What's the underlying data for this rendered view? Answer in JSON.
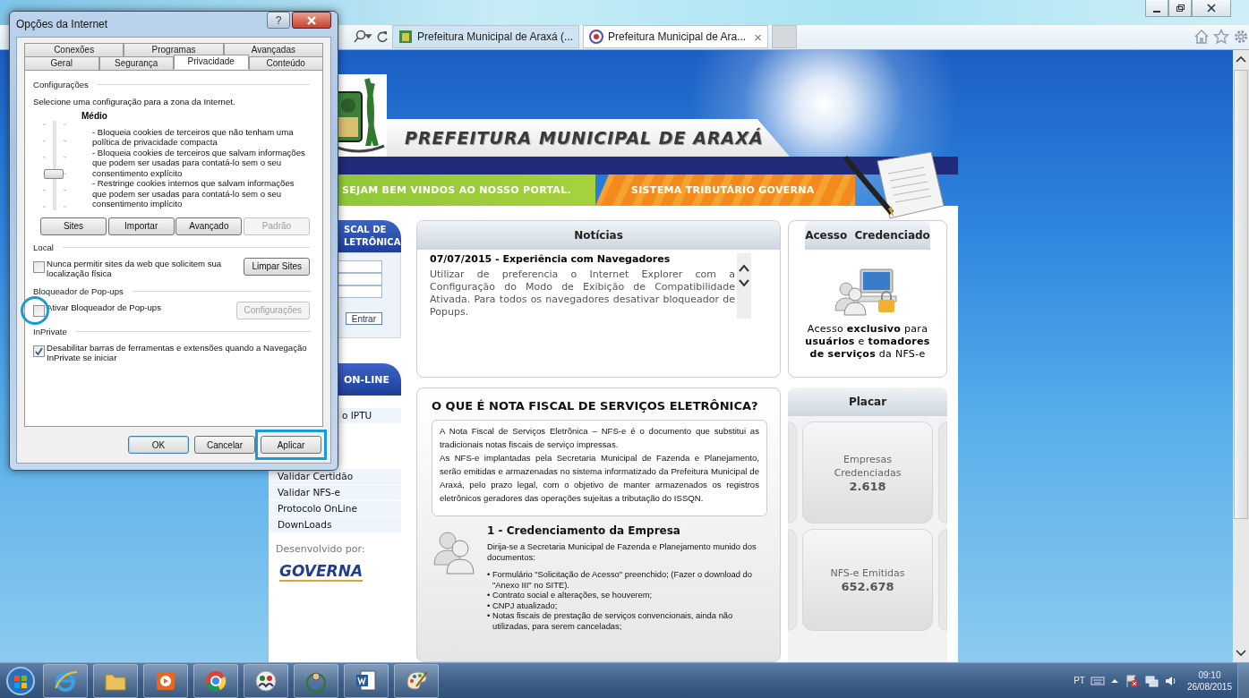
{
  "browser": {
    "tabs": [
      {
        "title": "Prefeitura Municipal de Araxá (...",
        "selected": false
      },
      {
        "title": "Prefeitura Municipal de Ara...",
        "selected": true
      }
    ],
    "tab_close": "×"
  },
  "site": {
    "title": "PREFEITURA MUNICIPAL DE ARAXÁ",
    "welcome": "SEJAM BEM VINDOS AO NOSSO PORTAL.",
    "system": "SISTEMA TRIBUTÁRIO GOVERNA",
    "login": {
      "title_lines": [
        "SCAL DE",
        "LETRÔNICA"
      ],
      "button": "Entrar"
    },
    "online": {
      "title": "ON-LINE",
      "links": [
        "o IPTU",
        "Validar Certidão",
        "Validar NFS-e",
        "Protocolo OnLine",
        "DownLoads"
      ]
    },
    "developed_by": "Desenvolvido por:",
    "developer": "GOVERNA",
    "news": {
      "title": "Notícias",
      "item_title": "07/07/2015 - Experiência com Navegadores",
      "item_text": "Utilizar de preferencia o Internet Explorer com a Configuração do Modo de Exibição de Compatibilidade Ativada. Para todos os navegadores desativar bloqueador de Popups."
    },
    "access": {
      "title": "Acesso  Credenciado",
      "text": "Acesso **exclusivo** para **usuários** e **tomadores de serviços** da NFS-e"
    },
    "about": {
      "title": "O QUE É NOTA FISCAL DE SERVIÇOS ELETRÔNICA?",
      "paragraphs": [
        "A Nota Fiscal de Serviços Eletrônica – NFS-e é o documento que substitui as tradicionais notas fiscais de serviço impressas.",
        "As NFS-e implantadas pela Secretaria Municipal de Fazenda e Planejamento, serão emitidas e armazenadas no sistema informatizado da Prefeitura Municipal de Araxá, pelo prazo legal, com o objetivo de manter armazenados os registros eletrônicos geradores das operações sujeitas a tributação do ISSQN."
      ],
      "step_title": "1 - Credenciamento da Empresa",
      "step_intro": "Dirija-se a Secretaria Municipal de Fazenda e Planejamento munido dos documentos:",
      "bullets": [
        "• Formulário \"Solicitação de Acesso\" preenchido;  (Fazer o download do \"Anexo III\" no SITE).",
        "• Contrato social e alterações, se houverem;",
        "• CNPJ atualizado;",
        "• Notas fiscais de prestação de serviços convencionais, ainda não utilizadas, para serem canceladas;"
      ]
    },
    "scoreboard": {
      "title": "Placar",
      "cards": [
        {
          "label": "Empresas Credenciadas",
          "value": "2.618"
        },
        {
          "label": "NFS-e Emitidas",
          "value": "652.678"
        }
      ]
    }
  },
  "dialog": {
    "title": "Opções da Internet",
    "help": "?",
    "tab_rows": [
      {
        "tabs": [
          {
            "label": "Conexões",
            "selected": false
          },
          {
            "label": "Programas",
            "selected": false
          },
          {
            "label": "Avançadas",
            "selected": false
          }
        ]
      },
      {
        "tabs": [
          {
            "label": "Geral",
            "selected": false
          },
          {
            "label": "Segurança",
            "selected": false
          },
          {
            "label": "Privacidade",
            "selected": true
          },
          {
            "label": "Conteúdo",
            "selected": false
          }
        ]
      }
    ],
    "settings": {
      "heading": "Configurações",
      "instruction": "Selecione uma configuração para a zona da Internet.",
      "level_name": "Médio",
      "slider": {
        "level": 0.4
      },
      "description": [
        "- Bloqueia cookies de terceiros que não tenham uma política de privacidade compacta",
        "- Bloqueia cookies de terceiros que salvam informações que podem ser usadas para contatá-lo sem o seu consentimento explícito",
        "- Restringe cookies internos que salvam informações que podem ser usadas para contatá-lo sem o seu consentimento implícito"
      ],
      "buttons": [
        {
          "label": "Sites",
          "disabled": false
        },
        {
          "label": "Importar",
          "disabled": false
        },
        {
          "label": "Avançado",
          "disabled": false
        },
        {
          "label": "Padrão",
          "disabled": true
        }
      ]
    },
    "groups": [
      {
        "heading": "Local",
        "option": {
          "label": "Nunca permitir sites da web que solicitem sua localização física",
          "checked": false,
          "highlighted": false
        },
        "button": {
          "label": "Limpar Sites",
          "disabled": false
        }
      },
      {
        "heading": "Bloqueador de Pop-ups",
        "option": {
          "label": "Ativar Bloqueador de Pop-ups",
          "checked": false,
          "highlighted": true
        },
        "button": {
          "label": "Configurações",
          "disabled": true
        }
      },
      {
        "heading": "InPrivate",
        "option": {
          "label": "Desabilitar barras de ferramentas e extensões quando a Navegação InPrivate se iniciar",
          "checked": true,
          "highlighted": false
        }
      }
    ],
    "footer_buttons": [
      {
        "label": "OK",
        "default": true,
        "highlighted": false
      },
      {
        "label": "Cancelar",
        "default": false,
        "highlighted": false
      },
      {
        "label": "Aplicar",
        "default": false,
        "highlighted": true
      }
    ]
  },
  "taskbar": {
    "language": "PT",
    "time": "09:10",
    "date": "26/08/2015"
  }
}
